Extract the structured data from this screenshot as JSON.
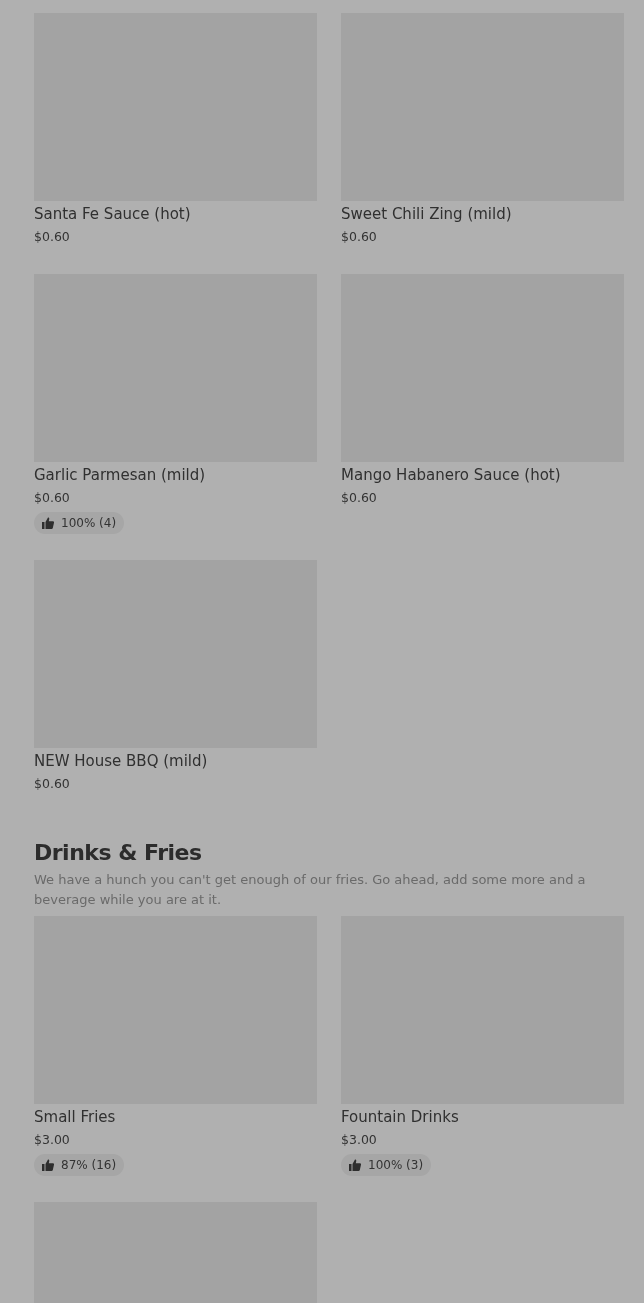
{
  "sections": [
    {
      "items": [
        {
          "kind": "product",
          "name": "Santa Fe Sauce (hot)",
          "price": "$0.60"
        },
        {
          "kind": "product",
          "name": "Sweet Chili Zing (mild)",
          "price": "$0.60"
        },
        {
          "kind": "product",
          "name": "Garlic Parmesan (mild)",
          "price": "$0.60",
          "rating": "100% (4)"
        },
        {
          "kind": "product",
          "name": "Mango Habanero Sauce (hot)",
          "price": "$0.60"
        },
        {
          "kind": "product",
          "name": "NEW House BBQ (mild)",
          "price": "$0.60"
        }
      ]
    },
    {
      "title": "Drinks & Fries",
      "description": "We have a hunch you can't get enough of our fries. Go ahead, add some more and a beverage while you are at it.",
      "items": [
        {
          "kind": "product",
          "name": "Small Fries",
          "price": "$3.00",
          "rating": "87% (16)"
        },
        {
          "kind": "product",
          "name": "Fountain Drinks",
          "price": "$3.00",
          "rating": "100% (3)"
        },
        {
          "kind": "product"
        }
      ]
    }
  ]
}
